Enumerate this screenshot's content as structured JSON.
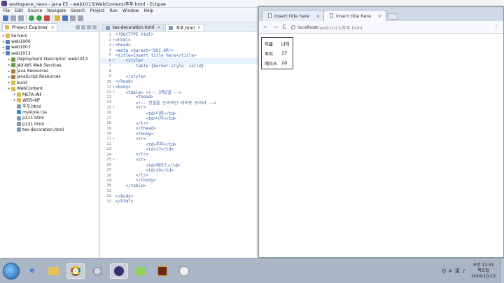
{
  "eclipse": {
    "title": "workspace_neon - Java EE - web1013/WebContent/푸푸.html - Eclipse",
    "menu": [
      "File",
      "Edit",
      "Source",
      "Navigate",
      "Search",
      "Project",
      "Run",
      "Window",
      "Help"
    ],
    "explorer": {
      "tab_label": "Project Explorer",
      "tree": [
        {
          "label": "Servers",
          "icon": "folder",
          "indent": 0,
          "arrow": "▸"
        },
        {
          "label": "web1006",
          "icon": "project",
          "indent": 0,
          "arrow": "▸"
        },
        {
          "label": "web1007",
          "icon": "project",
          "indent": 0,
          "arrow": "▸"
        },
        {
          "label": "web1013",
          "icon": "project",
          "indent": 0,
          "arrow": "▾"
        },
        {
          "label": "Deployment Descriptor: web1013",
          "icon": "web",
          "indent": 1,
          "arrow": "▸"
        },
        {
          "label": "JAX-WS Web Services",
          "icon": "web",
          "indent": 1,
          "arrow": "▸"
        },
        {
          "label": "Java Resources",
          "icon": "jar",
          "indent": 1,
          "arrow": "▸"
        },
        {
          "label": "JavaScript Resources",
          "icon": "jar",
          "indent": 1,
          "arrow": "▸"
        },
        {
          "label": "build",
          "icon": "folder",
          "indent": 1,
          "arrow": "▸"
        },
        {
          "label": "WebContent",
          "icon": "folder",
          "indent": 1,
          "arrow": "▾"
        },
        {
          "label": "META-INF",
          "icon": "folder",
          "indent": 2,
          "arrow": "▸"
        },
        {
          "label": "WEB-INF",
          "icon": "folder",
          "indent": 2,
          "arrow": "▸"
        },
        {
          "label": "푸푸.html",
          "icon": "file",
          "indent": 2,
          "arrow": ""
        },
        {
          "label": "mystyle.css",
          "icon": "css",
          "indent": 2,
          "arrow": ""
        },
        {
          "label": "p111.html",
          "icon": "file",
          "indent": 2,
          "arrow": ""
        },
        {
          "label": "p121.html",
          "icon": "file",
          "indent": 2,
          "arrow": ""
        },
        {
          "label": "tex-decoration.html",
          "icon": "file",
          "indent": 2,
          "arrow": ""
        }
      ]
    },
    "editor": {
      "tabs": [
        {
          "label": "tex-decoration.html",
          "active": false
        },
        {
          "label": "푸푸.html",
          "active": true
        }
      ],
      "lines": [
        {
          "n": "1",
          "text": "<!DOCTYPE html>"
        },
        {
          "n": "2",
          "text": "<html>",
          "fold": "⊖"
        },
        {
          "n": "3",
          "text": "<head>",
          "fold": "⊖"
        },
        {
          "n": "4",
          "text": "<meta charset=\"EUC-KR\">"
        },
        {
          "n": "5",
          "text": "<title>Insert title here</title>"
        },
        {
          "n": "6",
          "text": "    <style>",
          "fold": "⊖",
          "hl": true
        },
        {
          "n": "7",
          "text": "        table {border-style: solid}"
        },
        {
          "n": "8",
          "text": ""
        },
        {
          "n": "9",
          "text": "    </style>"
        },
        {
          "n": "10",
          "text": "</head>"
        },
        {
          "n": "11",
          "text": "<body>",
          "fold": "⊖"
        },
        {
          "n": "12",
          "text": "    <table> <!-- 3행2열 -->",
          "fold": "⊖"
        },
        {
          "n": "13",
          "text": "        <thead>"
        },
        {
          "n": "14",
          "text": "        <!-- 한셀을 논리적인 의미로 보이라 -->"
        },
        {
          "n": "15",
          "text": "        <tr>",
          "fold": "⊖"
        },
        {
          "n": "16",
          "text": "            <td>이름</td>"
        },
        {
          "n": "17",
          "text": "            <td>나이</td>"
        },
        {
          "n": "18",
          "text": "        </tr>"
        },
        {
          "n": "19",
          "text": "        </thead>"
        },
        {
          "n": "20",
          "text": "        <tbody>"
        },
        {
          "n": "21",
          "text": "        <tr>",
          "fold": "⊖"
        },
        {
          "n": "22",
          "text": "            <td>푸피</td>"
        },
        {
          "n": "23",
          "text": "            <td>17</td>"
        },
        {
          "n": "24",
          "text": "        </tr>"
        },
        {
          "n": "25",
          "text": "        <tr>",
          "fold": "⊖"
        },
        {
          "n": "26",
          "text": "            <td>에이스</td>"
        },
        {
          "n": "27",
          "text": "            <td>20</td>"
        },
        {
          "n": "28",
          "text": "        </tr>"
        },
        {
          "n": "29",
          "text": "        </tbody>"
        },
        {
          "n": "30",
          "text": "    </table>"
        },
        {
          "n": "31",
          "text": ""
        },
        {
          "n": "32",
          "text": "</body>"
        },
        {
          "n": "33",
          "text": "</html>"
        }
      ]
    }
  },
  "browser": {
    "tabs": [
      {
        "label": "Insert title here",
        "close": "×"
      },
      {
        "label": "Insert title here",
        "close": "×"
      }
    ],
    "nav": {
      "back": "←",
      "forward": "→",
      "reload": "C",
      "menu": "⋮"
    },
    "url_host": "localhost",
    "url_path": "/web1013/푸푸.html",
    "table": [
      [
        "이름",
        "나이"
      ],
      [
        "푸피",
        "17"
      ],
      [
        "에이스",
        "20"
      ]
    ]
  },
  "taskbar": {
    "tray_icons": [
      "Q",
      "A",
      "漢",
      "♪"
    ],
    "clock": {
      "time": "오전 11:31",
      "day": "목요일",
      "date": "2016-10-13"
    }
  }
}
